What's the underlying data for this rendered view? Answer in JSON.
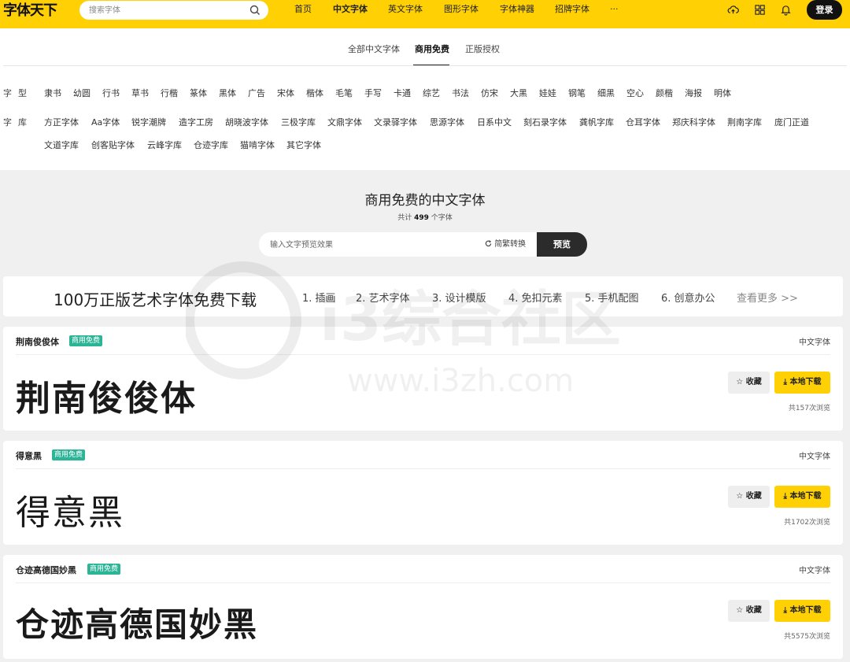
{
  "header": {
    "logo": "字体天下",
    "search_placeholder": "搜索字体",
    "nav": [
      "首页",
      "中文字体",
      "英文字体",
      "图形字体",
      "字体神器",
      "招牌字体",
      "···"
    ],
    "active_nav": "中文字体",
    "login": "登录"
  },
  "subnav": {
    "tabs": [
      "全部中文字体",
      "商用免费",
      "正版授权"
    ],
    "active": "商用免费"
  },
  "filters": {
    "type_label": "字型",
    "types": [
      "隶书",
      "幼圆",
      "行书",
      "草书",
      "行楷",
      "篆体",
      "黑体",
      "广告",
      "宋体",
      "楷体",
      "毛笔",
      "手写",
      "卡通",
      "综艺",
      "书法",
      "仿宋",
      "大黑",
      "娃娃",
      "钢笔",
      "细黑",
      "空心",
      "颜楷",
      "海报",
      "明体"
    ],
    "library_label": "字库",
    "libraries_row1": [
      "方正字体",
      "Aa字体",
      "锐字潮牌",
      "造字工房",
      "胡晓波字体",
      "三极字库",
      "文鼎字体",
      "文录驿字体",
      "思源字体",
      "日系中文",
      "刻石录字体",
      "龚帆字库",
      "仓耳字体",
      "郑庆科字体",
      "荆南字库",
      "庞门正道"
    ],
    "libraries_row2": [
      "文道字库",
      "创客贴字体",
      "云峰字库",
      "仓迹字库",
      "猫啃字体",
      "其它字体"
    ]
  },
  "hero": {
    "title": "商用免费的中文字体",
    "count_prefix": "共计",
    "count": "499",
    "count_suffix": "个字体",
    "preview_placeholder": "输入文字预览效果",
    "convert_label": "简繁转换",
    "preview_button": "预览"
  },
  "banner": {
    "title": "100万正版艺术字体免费下载",
    "links": [
      "1. 插画",
      "2. 艺术字体",
      "3. 设计模版",
      "4. 免扣元素",
      "5. 手机配图",
      "6. 创意办公"
    ],
    "more": "查看更多 >>"
  },
  "fonts": [
    {
      "name": "荆南俊俊体",
      "badge": "商用免费",
      "category": "中文字体",
      "sample": "荆南俊俊体",
      "fav": "收藏",
      "download": "本地下载",
      "views": "共157次浏览"
    },
    {
      "name": "得意黑",
      "badge": "商用免费",
      "category": "中文字体",
      "sample": "得意黑",
      "fav": "收藏",
      "download": "本地下载",
      "views": "共1702次浏览"
    },
    {
      "name": "仓迹高德国妙黑",
      "badge": "商用免费",
      "category": "中文字体",
      "sample": "仓迹高德国妙黑",
      "fav": "收藏",
      "download": "本地下载",
      "views": "共5575次浏览"
    }
  ],
  "watermark": {
    "text": "i3综合社区",
    "url": "www.i3zh.com"
  },
  "colors": {
    "brand_yellow": "#ffd105",
    "badge_green": "#2bb596",
    "dark": "#2b2b2b"
  }
}
